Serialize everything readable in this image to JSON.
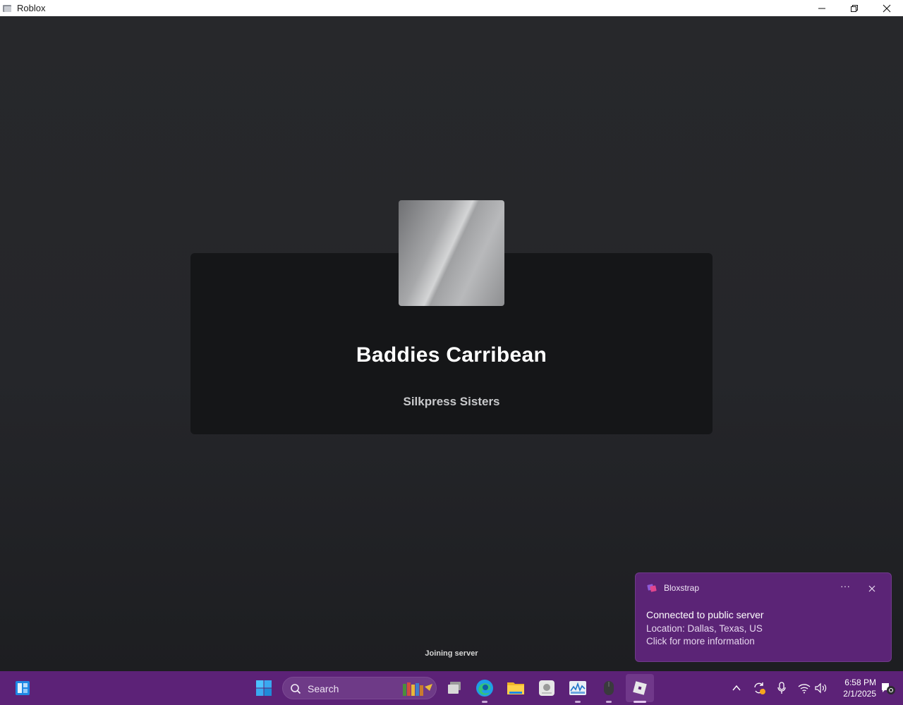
{
  "window": {
    "title": "Roblox"
  },
  "game": {
    "title": "Baddies Carribean",
    "creator": "Silkpress Sisters",
    "status": "Joining server"
  },
  "toast": {
    "app_name": "Bloxstrap",
    "title": "Connected to public server",
    "location": "Location: Dallas, Texas, US",
    "info": "Click for more information",
    "more_label": "···"
  },
  "taskbar": {
    "search_label": "Search",
    "time": "6:58 PM",
    "date": "2/1/2025",
    "apps": [
      "widgets-icon",
      "start-icon",
      "task-view-icon",
      "edge-icon",
      "file-explorer-icon",
      "game-launcher-icon",
      "task-manager-icon",
      "mouse-app-icon",
      "roblox-icon"
    ],
    "tray": [
      "show-hidden-icons",
      "sync-icon",
      "microphone-icon",
      "wifi-icon",
      "volume-icon",
      "notification-icon"
    ]
  },
  "colors": {
    "taskbar": "#5c2277",
    "toast": "#5b2476",
    "background": "#232427",
    "card": "#151618"
  }
}
